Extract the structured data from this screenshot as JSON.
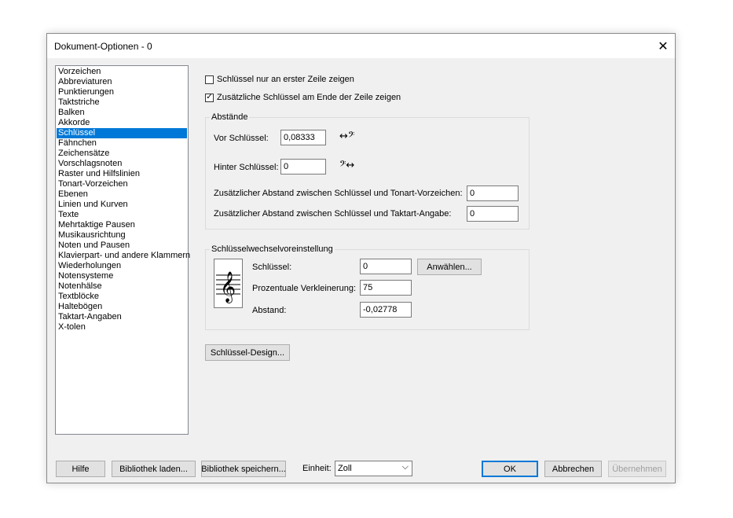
{
  "window": {
    "title": "Dokument-Optionen - 0",
    "close_glyph": "✕"
  },
  "nav": {
    "items": [
      "Vorzeichen",
      "Abbreviaturen",
      "Punktierungen",
      "Taktstriche",
      "Balken",
      "Akkorde",
      "Schlüssel",
      "Fähnchen",
      "Zeichensätze",
      "Vorschlagsnoten",
      "Raster und Hilfslinien",
      "Tonart-Vorzeichen",
      "Ebenen",
      "Linien und Kurven",
      "Texte",
      "Mehrtaktige Pausen",
      "Musikausrichtung",
      "Noten und Pausen",
      "Klavierpart- und andere Klammern",
      "Wiederholungen",
      "Notensysteme",
      "Notenhälse",
      "Textblöcke",
      "Haltebögen",
      "Taktart-Angaben",
      "X-tolen"
    ],
    "selected_index": 6
  },
  "options": {
    "first_line_only": {
      "label": "Schlüssel nur an erster Zeile zeigen",
      "checked": false
    },
    "end_of_line": {
      "label": "Zusätzliche Schlüssel am Ende der Zeile zeigen",
      "checked": true
    }
  },
  "spacing": {
    "title": "Abstände",
    "before_label": "Vor Schlüssel:",
    "before_value": "0,08333",
    "after_label": "Hinter Schlüssel:",
    "after_value": "0",
    "key_label": "Zusätzlicher Abstand zwischen Schlüssel und Tonart-Vorzeichen:",
    "key_value": "0",
    "time_label": "Zusätzlicher Abstand zwischen Schlüssel und Taktart-Angabe:",
    "time_value": "0",
    "before_symbol": "↔𝄢",
    "after_symbol": "𝄢↔"
  },
  "clef_change": {
    "title": "Schlüsselwechselvoreinstellung",
    "clef_label": "Schlüssel:",
    "clef_value": "0",
    "select_button": "Anwählen...",
    "reduction_label": "Prozentuale Verkleinerung:",
    "reduction_value": "75",
    "distance_label": "Abstand:",
    "distance_value": "-0,02778",
    "preview_icon": "treble-clef-icon"
  },
  "design_button": "Schlüssel-Design...",
  "footer": {
    "help": "Hilfe",
    "load": "Bibliothek laden...",
    "save": "Bibliothek speichern...",
    "unit_label": "Einheit:",
    "unit_value": "Zoll",
    "ok": "OK",
    "cancel": "Abbrechen",
    "apply": "Übernehmen"
  },
  "colors": {
    "selection": "#0078d7",
    "dialog_bg": "#f0f0f0"
  }
}
